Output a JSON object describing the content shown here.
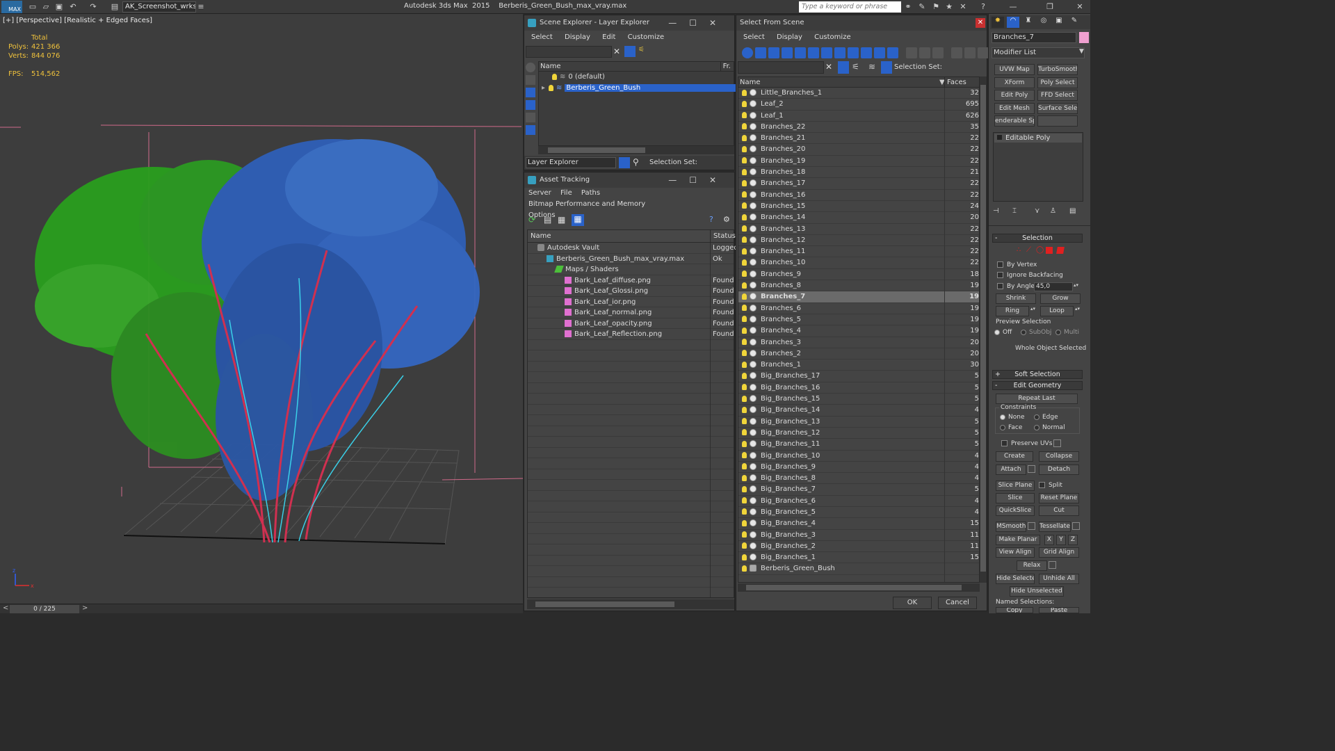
{
  "app": {
    "title": "Autodesk 3ds Max  2015    Berberis_Green_Bush_max_vray.max",
    "workspace": "AK_Screenshot_wrksp",
    "search_placeholder": "Type a keyword or phrase",
    "logo": "MAX"
  },
  "viewport": {
    "label": "[+] [Perspective] [Realistic + Edged Faces]",
    "stats": {
      "total_label": "Total",
      "polys_label": "Polys:",
      "polys_value": "421 366",
      "verts_label": "Verts:",
      "verts_value": "844 076",
      "fps_label": "FPS:",
      "fps_value": "514,562"
    },
    "timeline": "0 / 225",
    "axis_z": "z",
    "axis_x": "x"
  },
  "layer_explorer": {
    "title": "Scene Explorer - Layer Explorer",
    "menu": [
      "Select",
      "Display",
      "Edit",
      "Customize"
    ],
    "col_name": "Name",
    "col_fr": "Fr.",
    "rows": [
      "0 (default)",
      "Berberis_Green_Bush"
    ],
    "footer_dropdown": "Layer Explorer",
    "footer_selection_set": "Selection Set:"
  },
  "asset_tracking": {
    "title": "Asset Tracking",
    "menu": [
      "Server",
      "File",
      "Paths",
      "Bitmap Performance and Memory"
    ],
    "menu2": "Options",
    "col_name": "Name",
    "col_status": "Status",
    "rows": [
      {
        "name": "Autodesk Vault",
        "status": "Logged",
        "indent": 0
      },
      {
        "name": "Berberis_Green_Bush_max_vray.max",
        "status": "Ok",
        "indent": 1
      },
      {
        "name": "Maps / Shaders",
        "status": "",
        "indent": 2
      },
      {
        "name": "Bark_Leaf_diffuse.png",
        "status": "Found",
        "indent": 3
      },
      {
        "name": "Bark_Leaf_Glossi.png",
        "status": "Found",
        "indent": 3
      },
      {
        "name": "Bark_Leaf_ior.png",
        "status": "Found",
        "indent": 3
      },
      {
        "name": "Bark_Leaf_normal.png",
        "status": "Found",
        "indent": 3
      },
      {
        "name": "Bark_Leaf_opacity.png",
        "status": "Found",
        "indent": 3
      },
      {
        "name": "Bark_Leaf_Reflection.png",
        "status": "Found",
        "indent": 3
      }
    ]
  },
  "select_from_scene": {
    "title": "Select From Scene",
    "menu": [
      "Select",
      "Display",
      "Customize"
    ],
    "selection_set": "Selection Set:",
    "col_name": "Name",
    "col_faces": "Faces",
    "rows": [
      {
        "name": "Little_Branches_1",
        "faces": "32"
      },
      {
        "name": "Leaf_2",
        "faces": "695"
      },
      {
        "name": "Leaf_1",
        "faces": "626"
      },
      {
        "name": "Branches_22",
        "faces": "35"
      },
      {
        "name": "Branches_21",
        "faces": "22"
      },
      {
        "name": "Branches_20",
        "faces": "22"
      },
      {
        "name": "Branches_19",
        "faces": "22"
      },
      {
        "name": "Branches_18",
        "faces": "21"
      },
      {
        "name": "Branches_17",
        "faces": "22"
      },
      {
        "name": "Branches_16",
        "faces": "22"
      },
      {
        "name": "Branches_15",
        "faces": "24"
      },
      {
        "name": "Branches_14",
        "faces": "20"
      },
      {
        "name": "Branches_13",
        "faces": "22"
      },
      {
        "name": "Branches_12",
        "faces": "22"
      },
      {
        "name": "Branches_11",
        "faces": "22"
      },
      {
        "name": "Branches_10",
        "faces": "22"
      },
      {
        "name": "Branches_9",
        "faces": "18"
      },
      {
        "name": "Branches_8",
        "faces": "19"
      },
      {
        "name": "Branches_7",
        "faces": "19"
      },
      {
        "name": "Branches_6",
        "faces": "19"
      },
      {
        "name": "Branches_5",
        "faces": "19"
      },
      {
        "name": "Branches_4",
        "faces": "19"
      },
      {
        "name": "Branches_3",
        "faces": "20"
      },
      {
        "name": "Branches_2",
        "faces": "20"
      },
      {
        "name": "Branches_1",
        "faces": "30"
      },
      {
        "name": "Big_Branches_17",
        "faces": "5"
      },
      {
        "name": "Big_Branches_16",
        "faces": "5"
      },
      {
        "name": "Big_Branches_15",
        "faces": "5"
      },
      {
        "name": "Big_Branches_14",
        "faces": "4"
      },
      {
        "name": "Big_Branches_13",
        "faces": "5"
      },
      {
        "name": "Big_Branches_12",
        "faces": "5"
      },
      {
        "name": "Big_Branches_11",
        "faces": "5"
      },
      {
        "name": "Big_Branches_10",
        "faces": "4"
      },
      {
        "name": "Big_Branches_9",
        "faces": "4"
      },
      {
        "name": "Big_Branches_8",
        "faces": "4"
      },
      {
        "name": "Big_Branches_7",
        "faces": "5"
      },
      {
        "name": "Big_Branches_6",
        "faces": "4"
      },
      {
        "name": "Big_Branches_5",
        "faces": "4"
      },
      {
        "name": "Big_Branches_4",
        "faces": "15"
      },
      {
        "name": "Big_Branches_3",
        "faces": "11"
      },
      {
        "name": "Big_Branches_2",
        "faces": "11"
      },
      {
        "name": "Big_Branches_1",
        "faces": "15"
      },
      {
        "name": "Berberis_Green_Bush",
        "faces": ""
      }
    ],
    "selected_index": 18,
    "ok": "OK",
    "cancel": "Cancel"
  },
  "command_panel": {
    "object_name": "Branches_7",
    "modifier_list": "Modifier List",
    "buttons": [
      [
        "UVW Map",
        "TurboSmooth"
      ],
      [
        "XForm",
        "Poly Select"
      ],
      [
        "Edit Poly",
        "FFD Select"
      ],
      [
        "Edit Mesh",
        "Surface Select"
      ],
      [
        "enderable Spli",
        ""
      ]
    ],
    "stack_item": "Editable Poly",
    "selection_header": "Selection",
    "by_vertex": "By Vertex",
    "ignore_backfacing": "Ignore Backfacing",
    "by_angle": "By Angle:",
    "by_angle_value": "45,0",
    "shrink": "Shrink",
    "grow": "Grow",
    "ring": "Ring",
    "loop": "Loop",
    "preview_selection": "Preview Selection",
    "preview_off": "Off",
    "preview_subobj": "SubObj",
    "preview_multi": "Multi",
    "whole_object": "Whole Object Selected",
    "soft_selection": "Soft Selection",
    "edit_geometry": "Edit Geometry",
    "repeat_last": "Repeat Last",
    "constraints": "Constraints",
    "c_none": "None",
    "c_edge": "Edge",
    "c_face": "Face",
    "c_normal": "Normal",
    "preserve_uvs": "Preserve UVs",
    "create": "Create",
    "collapse": "Collapse",
    "attach": "Attach",
    "detach": "Detach",
    "slice_plane": "Slice Plane",
    "split": "Split",
    "slice": "Slice",
    "reset_plane": "Reset Plane",
    "quickslice": "QuickSlice",
    "cut": "Cut",
    "msmooth": "MSmooth",
    "tessellate": "Tessellate",
    "make_planar": "Make Planar",
    "x": "X",
    "y": "Y",
    "z": "Z",
    "view_align": "View Align",
    "grid_align": "Grid Align",
    "relax": "Relax",
    "hide_selected": "Hide Selected",
    "unhide_all": "Unhide All",
    "hide_unselected": "Hide Unselected",
    "named_selections": "Named Selections:",
    "copy": "Copy",
    "paste": "Paste"
  },
  "colors": {
    "accent_blue": "#2a62c9",
    "stats_yellow": "#f0c23c",
    "selection_red": "#e02020"
  }
}
